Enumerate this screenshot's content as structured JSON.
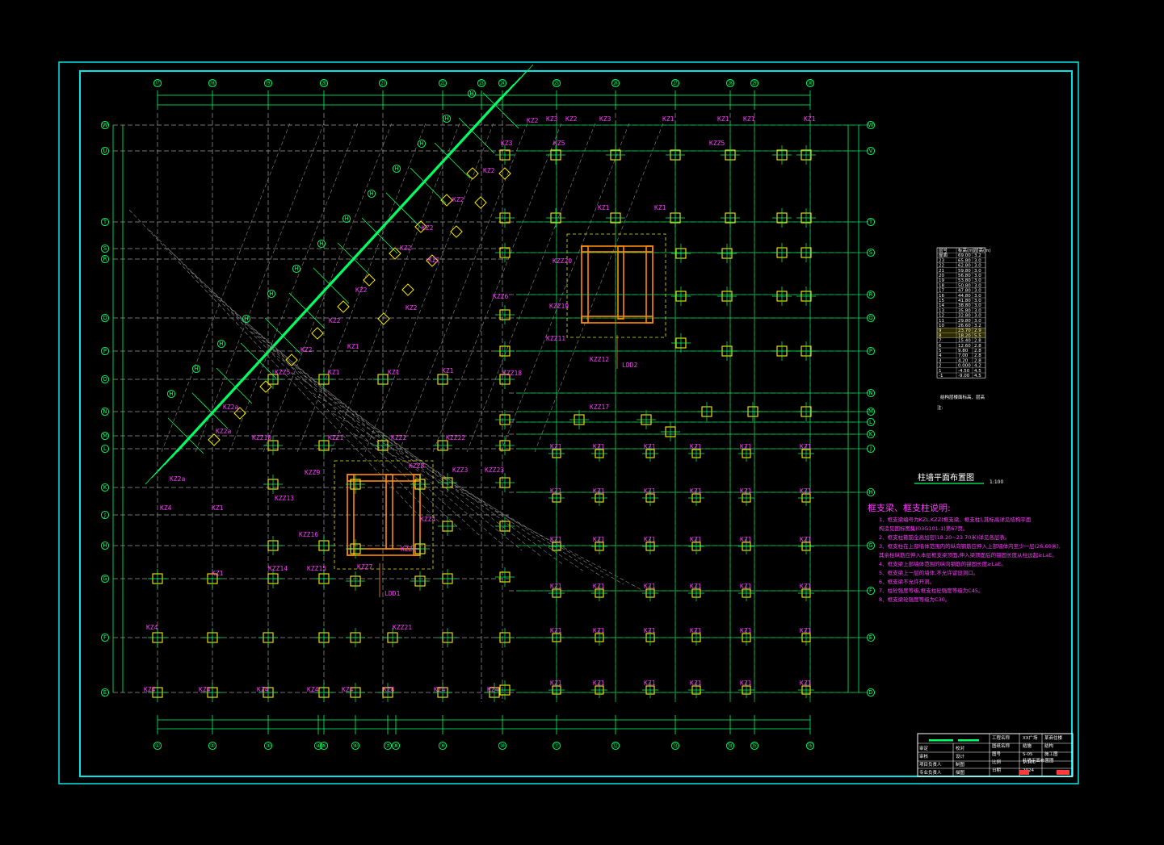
{
  "drawing": {
    "plan_title": "柱墙平面布置图",
    "plan_scale": "1:100",
    "notes_heading": "框支梁、框支柱说明:",
    "notes": [
      "1、框支梁编号为KZL,KZZ(框支梁、框支柱),其标高详见结构平面",
      "   构造见国标图集(03G101-1)第67页。",
      "2、框支柱箍筋全高加密(18.20~23.70米)详见各层表。",
      "3、框支柱在上部墙体范围内的纵向钢筋应伸入上部墙体内至少一层(26.60米),",
      "   其余柱纵筋应伸入本层框支梁顶面,伸入梁顶面后的锚固长度从柱边起≥LaE。",
      "4、框支梁上部墙体范围的纵向钢筋的锚固长度≥LaE。",
      "5、框支梁上一层的墙体,不允许留设洞口。",
      "6、框支梁不允许开洞。",
      "7、柱砼强度等级,框支柱砼强度等级为C45。",
      "8、框支梁砼强度等级为C30。"
    ],
    "top_axes": [
      "⑰",
      "⑱",
      "⑲",
      "⑳",
      "㉑",
      "㉒",
      "㉓",
      "㉔",
      "㉕",
      "㉖",
      "㉗",
      "㉘",
      "㉙",
      "㉚",
      "㉛"
    ],
    "bottom_axes": [
      "①",
      "②",
      "③",
      "④",
      "⑤",
      "⑥",
      "⑦",
      "⑧",
      "⑨",
      "⑩",
      "⑪",
      "⑫",
      "⑬",
      "⑭",
      "⑮",
      "⑯"
    ],
    "left_axes": [
      "W",
      "U",
      "T",
      "S",
      "R",
      "Q",
      "P",
      "O",
      "N",
      "M",
      "L",
      "K",
      "J",
      "H",
      "G",
      "F",
      "E",
      "D",
      "C",
      "B",
      "A"
    ],
    "right_axes": [
      "W",
      "V",
      "T",
      "S",
      "R",
      "Q",
      "P",
      "N",
      "M",
      "L",
      "K",
      "J",
      "H",
      "G",
      "F",
      "E",
      "D",
      "C",
      "B",
      "A"
    ],
    "diag_axes": [
      "H",
      "H",
      "H",
      "H",
      "H",
      "H",
      "H",
      "H",
      "H",
      "H",
      "H",
      "H",
      "H"
    ],
    "wall_labels": [
      "LDD2",
      "LDD1"
    ],
    "column_grid_label": "KZ1",
    "column_labels": [
      "KZ2",
      "KZ3",
      "KZ2",
      "KZ2",
      "KZ2",
      "KZ2",
      "KZ2",
      "KZ2",
      "KZ1",
      "KZ1",
      "KZ1",
      "KZ1",
      "KZ2",
      "KZ2",
      "KZ2",
      "KZ1",
      "KZ1",
      "KZ1",
      "KZ2",
      "KZ3",
      "KZ3",
      "KZ5",
      "KZZ5",
      "KZZ5",
      "KZ1",
      "KZ1",
      "KZZ10",
      "KZZ1",
      "KZZ2",
      "KZZ3",
      "KZZ4",
      "KZZ5",
      "KZZ6",
      "KZZ7",
      "KZZ8",
      "KZZ9",
      "KZZ11",
      "KZZ12",
      "KZZ13",
      "KZZ14",
      "KZZ15",
      "KZZ16",
      "KZZ17",
      "KZZ18",
      "KZZ19",
      "KZZ20",
      "KZZ21",
      "KZZ22",
      "KZZ23",
      "KZ4",
      "KZ4",
      "KZ4",
      "KZ4",
      "KZ4",
      "KZ4",
      "KZ4",
      "KZ4",
      "KZ4",
      "KZ2a",
      "KZ2a",
      "KZ2a",
      "KZ4",
      "KZ1",
      "KZ1",
      "KZ1"
    ],
    "level_table_header": [
      "层号",
      "标高(m)",
      "层高(m)"
    ],
    "level_table_rows": [
      [
        "屋面",
        "69.00",
        "3.2"
      ],
      [
        "23",
        "65.80",
        "3.0"
      ],
      [
        "22",
        "62.80",
        "3.0"
      ],
      [
        "21",
        "59.80",
        "3.0"
      ],
      [
        "20",
        "56.80",
        "3.0"
      ],
      [
        "19",
        "53.80",
        "3.0"
      ],
      [
        "18",
        "50.80",
        "3.0"
      ],
      [
        "17",
        "47.80",
        "3.0"
      ],
      [
        "16",
        "44.80",
        "3.0"
      ],
      [
        "15",
        "41.80",
        "3.0"
      ],
      [
        "14",
        "38.80",
        "3.0"
      ],
      [
        "13",
        "35.80",
        "3.0"
      ],
      [
        "12",
        "32.80",
        "3.0"
      ],
      [
        "11",
        "29.80",
        "3.0"
      ],
      [
        "10",
        "26.60",
        "3.2"
      ],
      [
        "9",
        "23.70",
        "2.9"
      ],
      [
        "8",
        "18.20",
        "5.5"
      ],
      [
        "7",
        "15.40",
        "2.8"
      ],
      [
        "6",
        "12.60",
        "2.8"
      ],
      [
        "5",
        "9.80",
        "2.8"
      ],
      [
        "4",
        "7.00",
        "2.8"
      ],
      [
        "3",
        "4.20",
        "2.8"
      ],
      [
        "2",
        "0.000",
        "4.2"
      ],
      [
        "1",
        "-4.50",
        "4.5"
      ],
      [
        "-1",
        "-9.00",
        "4.5"
      ]
    ],
    "level_table_caption": "结构层楼面标高、层高",
    "level_table_note": "注:",
    "title_block": {
      "project": "某商住楼",
      "drawing_name": "柱墙平面布置图",
      "discipline": "结构",
      "stage": "施工图",
      "rows_left": [
        "审定",
        "审核",
        "项目负责人",
        "专业负责人"
      ],
      "rows_mid": [
        "校对",
        "设计",
        "制图",
        "描图"
      ],
      "fields": [
        "工程名称",
        "图纸名称",
        "图号",
        "比例",
        "日期"
      ],
      "values": [
        "XX广场",
        "结施",
        "S-05",
        "1:100",
        "2024"
      ]
    }
  }
}
